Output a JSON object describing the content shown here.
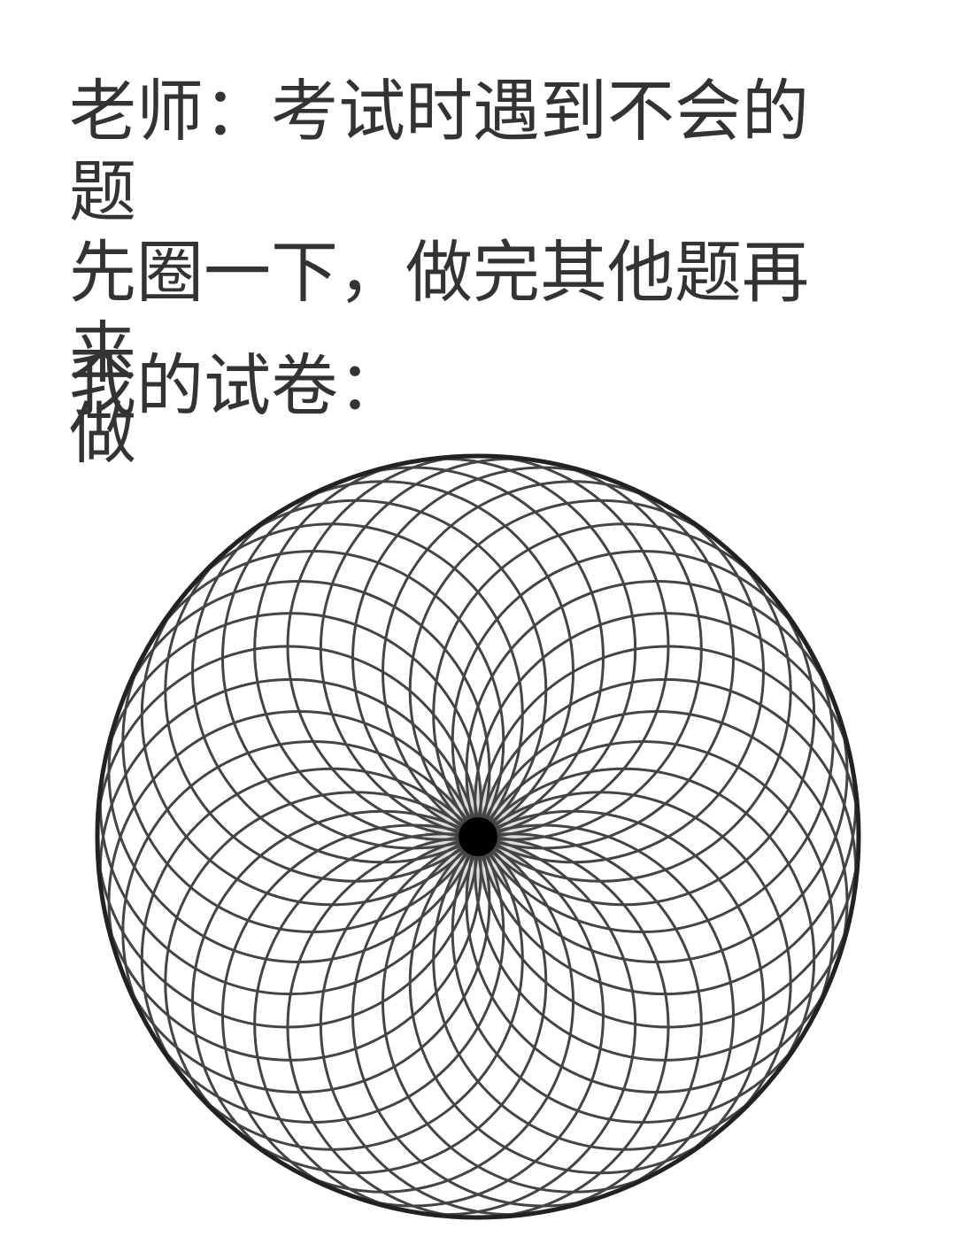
{
  "teacher_caption": "老师：考试时遇到不会的题\n先圈一下，做完其他题再来\n做",
  "my_paper_label": "我的试卷：",
  "figure": {
    "icon": "circle-pattern-icon",
    "stroke_color": "#444444",
    "rim_color": "#222222",
    "center_color": "#000000"
  }
}
